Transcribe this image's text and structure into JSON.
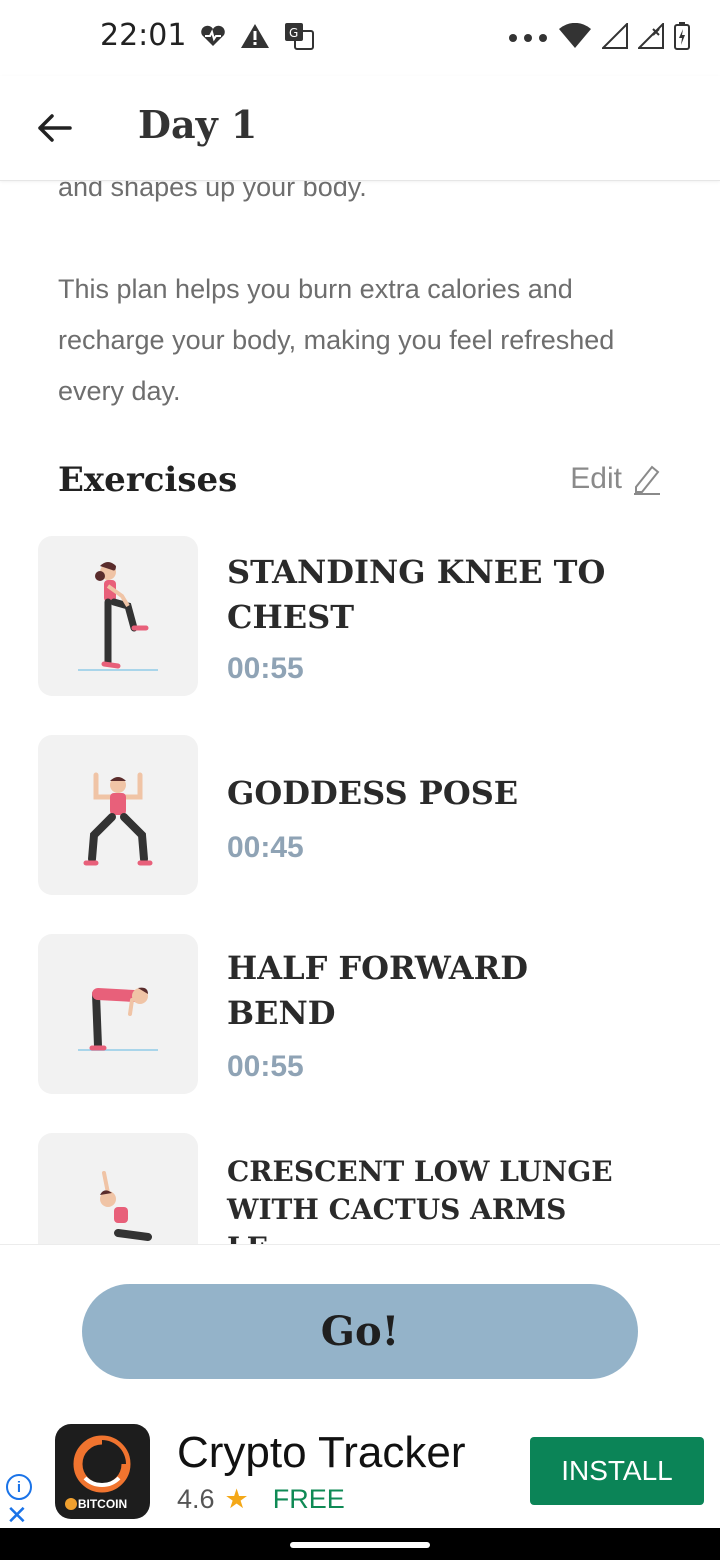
{
  "status_bar": {
    "time": "22:01",
    "icons": [
      "health-icon",
      "warning-icon",
      "translate-icon",
      "more-dots-icon",
      "wifi-icon",
      "signal-icon",
      "signal-x-icon",
      "battery-charging-icon"
    ]
  },
  "app_bar": {
    "title": "Day 1",
    "back_icon": "arrow-left-icon"
  },
  "description": {
    "partial_line": "and shapes up your body.",
    "paragraph": "This plan helps you burn extra calories and recharge your body, making you feel refreshed every day."
  },
  "exercises_section": {
    "title": "Exercises",
    "edit_label": "Edit",
    "edit_icon": "pencil-icon",
    "items": [
      {
        "name": "STANDING KNEE TO CHEST",
        "duration": "00:55"
      },
      {
        "name": "GODDESS POSE",
        "duration": "00:45"
      },
      {
        "name": "HALF FORWARD BEND",
        "duration": "00:55"
      },
      {
        "name": "CRESCENT LOW LUNGE WITH CACTUS ARMS LE...",
        "duration": ""
      }
    ]
  },
  "go_button": {
    "label": "Go!",
    "color": "#94b3c9"
  },
  "ad": {
    "title": "Crypto Tracker",
    "rating": "4.6",
    "price": "FREE",
    "install_label": "INSTALL",
    "icon_label": "BITCOIN",
    "install_color": "#0b8457"
  }
}
